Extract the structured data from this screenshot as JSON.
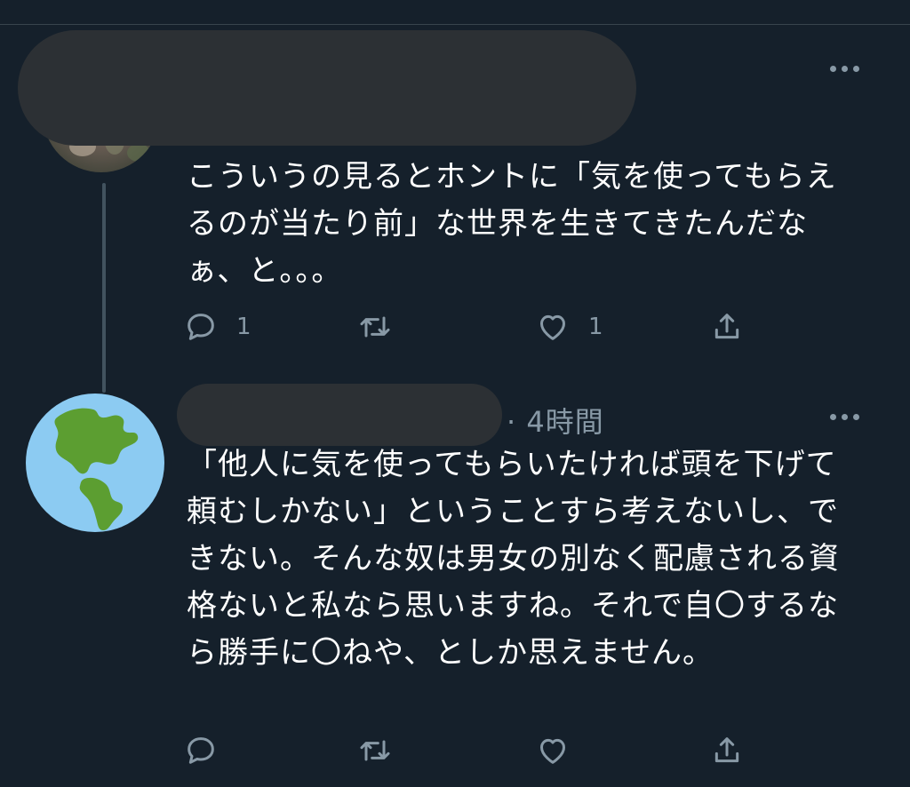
{
  "tweets": [
    {
      "text": "こういうの見るとホントに「気を使ってもらえるのが当たり前」な世界を生きてきたんだなぁ、と。。。",
      "actions": {
        "reply_count": "1",
        "retweet_count": "",
        "like_count": "1"
      }
    },
    {
      "time": "· 4時間",
      "text": "「他人に気を使ってもらいたければ頭を下げて頼むしかない」ということすら考えないし、できない。そんな奴は男女の別なく配慮される資格ないと私なら思いますね。それで自〇するなら勝手に〇ねや、としか思えません。",
      "avatar_icon": "earth-americas-icon",
      "actions": {
        "reply_count": "",
        "retweet_count": "",
        "like_count": ""
      }
    }
  ],
  "icons": {
    "reply": "reply-icon",
    "retweet": "retweet-icon",
    "like": "like-icon",
    "share": "share-icon",
    "more": "more-icon"
  },
  "colors": {
    "background": "#15202b",
    "text": "#ffffff",
    "secondary": "#8899a6",
    "redaction": "#2c3034",
    "thread_line": "#42535f"
  }
}
